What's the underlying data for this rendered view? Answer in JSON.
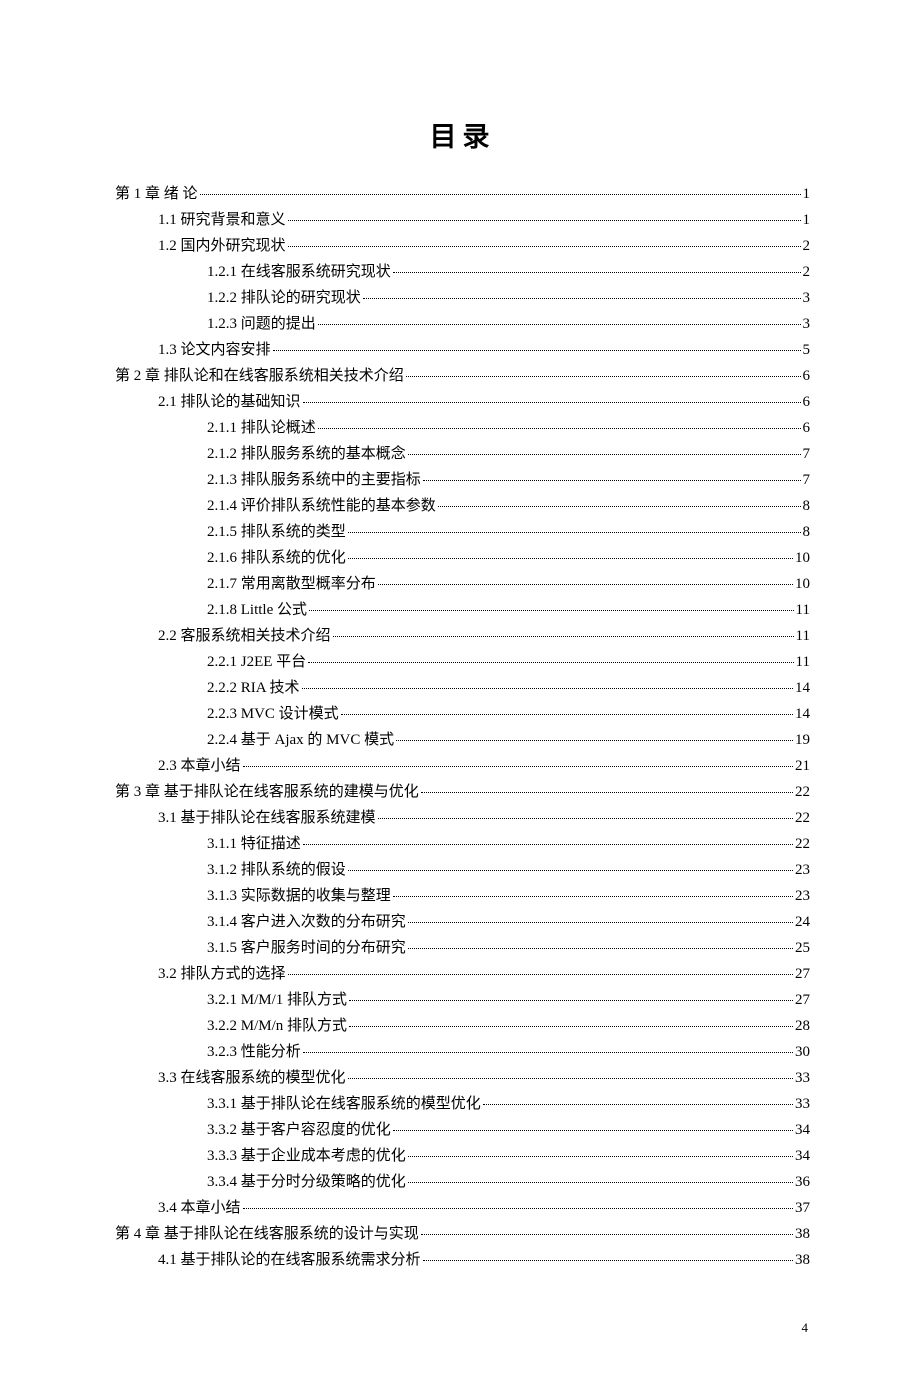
{
  "title": "目录",
  "page_number": "4",
  "entries": [
    {
      "level": 0,
      "label": "第 1 章  绪  论",
      "page": "1"
    },
    {
      "level": 1,
      "label": "1.1  研究背景和意义",
      "page": "1"
    },
    {
      "level": 1,
      "label": "1.2  国内外研究现状",
      "page": "2"
    },
    {
      "level": 2,
      "label": "1.2.1  在线客服系统研究现状",
      "page": "2"
    },
    {
      "level": 2,
      "label": "1.2.2  排队论的研究现状",
      "page": "3"
    },
    {
      "level": 2,
      "label": "1.2.3  问题的提出",
      "page": "3"
    },
    {
      "level": 1,
      "label": "1.3  论文内容安排",
      "page": "5"
    },
    {
      "level": 0,
      "label": "第 2 章  排队论和在线客服系统相关技术介绍",
      "page": "6"
    },
    {
      "level": 1,
      "label": "2.1 排队论的基础知识",
      "page": "6"
    },
    {
      "level": 2,
      "label": "2.1.1  排队论概述",
      "page": "6"
    },
    {
      "level": 2,
      "label": "2.1.2  排队服务系统的基本概念",
      "page": "7"
    },
    {
      "level": 2,
      "label": "2.1.3  排队服务系统中的主要指标",
      "page": "7"
    },
    {
      "level": 2,
      "label": "2.1.4  评价排队系统性能的基本参数",
      "page": "8"
    },
    {
      "level": 2,
      "label": "2.1.5  排队系统的类型",
      "page": "8"
    },
    {
      "level": 2,
      "label": "2.1.6  排队系统的优化",
      "page": "10"
    },
    {
      "level": 2,
      "label": "2.1.7  常用离散型概率分布",
      "page": "10"
    },
    {
      "level": 2,
      "label": "2.1.8 Little 公式",
      "page": "11"
    },
    {
      "level": 1,
      "label": "2.2  客服系统相关技术介绍",
      "page": "11"
    },
    {
      "level": 2,
      "label": "2.2.1 J2EE 平台",
      "page": "11"
    },
    {
      "level": 2,
      "label": "2.2.2 RIA 技术",
      "page": "14"
    },
    {
      "level": 2,
      "label": "2.2.3 MVC 设计模式",
      "page": "14"
    },
    {
      "level": 2,
      "label": "2.2.4 基于 Ajax 的 MVC 模式",
      "page": "19"
    },
    {
      "level": 1,
      "label": "2.3  本章小结",
      "page": "21"
    },
    {
      "level": 0,
      "label": "第 3 章  基于排队论在线客服系统的建模与优化",
      "page": "22"
    },
    {
      "level": 1,
      "label": "3.1  基于排队论在线客服系统建模",
      "page": "22"
    },
    {
      "level": 2,
      "label": "3.1.1  特征描述",
      "page": "22"
    },
    {
      "level": 2,
      "label": "3.1.2  排队系统的假设",
      "page": "23"
    },
    {
      "level": 2,
      "label": "3.1.3  实际数据的收集与整理",
      "page": "23"
    },
    {
      "level": 2,
      "label": "3.1.4  客户进入次数的分布研究",
      "page": "24"
    },
    {
      "level": 2,
      "label": "3.1.5  客户服务时间的分布研究",
      "page": "25"
    },
    {
      "level": 1,
      "label": "3.2  排队方式的选择",
      "page": "27"
    },
    {
      "level": 2,
      "label": "3.2.1 M/M/1 排队方式",
      "page": "27"
    },
    {
      "level": 2,
      "label": "3.2.2 M/M/n 排队方式",
      "page": "28"
    },
    {
      "level": 2,
      "label": "3.2.3  性能分析",
      "page": "30"
    },
    {
      "level": 1,
      "label": "3.3  在线客服系统的模型优化",
      "page": "33"
    },
    {
      "level": 2,
      "label": "3.3.1  基于排队论在线客服系统的模型优化",
      "page": "33"
    },
    {
      "level": 2,
      "label": "3.3.2  基于客户容忍度的优化",
      "page": "34"
    },
    {
      "level": 2,
      "label": "3.3.3  基于企业成本考虑的优化",
      "page": "34"
    },
    {
      "level": 2,
      "label": "3.3.4  基于分时分级策略的优化",
      "page": "36"
    },
    {
      "level": 1,
      "label": "3.4  本章小结",
      "page": "37"
    },
    {
      "level": 0,
      "label": "第 4 章  基于排队论在线客服系统的设计与实现",
      "page": "38"
    },
    {
      "level": 1,
      "label": "4.1  基于排队论的在线客服系统需求分析",
      "page": "38"
    }
  ]
}
